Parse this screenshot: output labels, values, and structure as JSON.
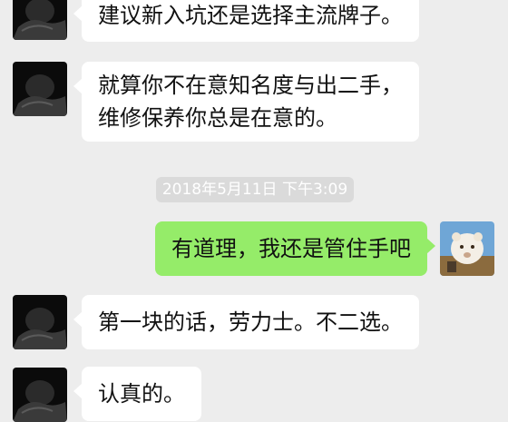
{
  "chat": {
    "messages": [
      {
        "sender": "other",
        "lines": [
          "建议新入坑还是选择主流牌子。"
        ]
      },
      {
        "sender": "other",
        "lines": [
          "就算你不在意知名度与出二手，",
          "维修保养你总是在意的。"
        ]
      },
      {
        "sender": "self",
        "lines": [
          "有道理，我还是管住手吧"
        ]
      },
      {
        "sender": "other",
        "lines": [
          "第一块的话，劳力士。不二选。"
        ]
      },
      {
        "sender": "other",
        "lines": [
          "认真的。"
        ]
      }
    ],
    "timestamp": "2018年5月11日 下午3:09"
  },
  "colors": {
    "background": "#ededed",
    "incoming_bubble": "#ffffff",
    "outgoing_bubble": "#95ec69",
    "timestamp_pill": "#dadada",
    "timestamp_text": "#ffffff"
  },
  "icons": {
    "contact_avatar": "dark-portrait-avatar",
    "self_avatar": "white-lion-cub-avatar"
  }
}
